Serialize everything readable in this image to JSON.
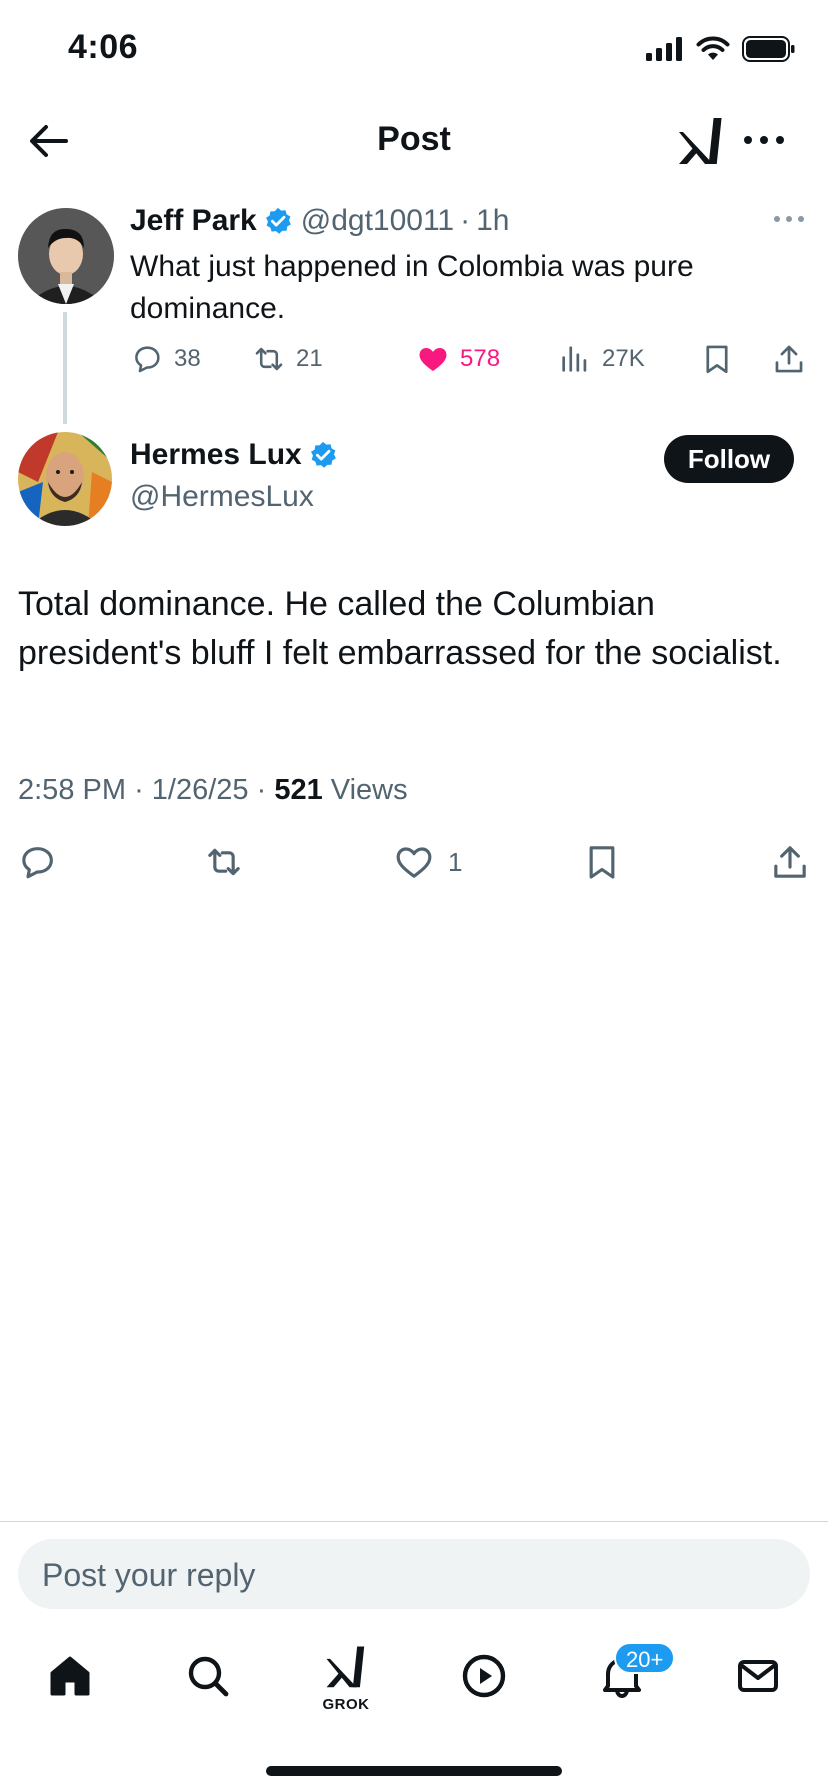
{
  "status_bar": {
    "time": "4:06"
  },
  "header": {
    "title": "Post"
  },
  "parent_post": {
    "author_name": "Jeff Park",
    "handle": "@dgt10011",
    "time_ago": "1h",
    "text": "What just happened in Colombia was pure dominance.",
    "replies": "38",
    "reposts": "21",
    "likes": "578",
    "views": "27K",
    "liked": true
  },
  "main_post": {
    "author_name": "Hermes Lux",
    "handle": "@HermesLux",
    "follow_label": "Follow",
    "text": "Total dominance. He called the Columbian president's bluff I felt embarrassed for the socialist.",
    "time": "2:58 PM",
    "date": "1/26/25",
    "views_count": "521",
    "views_label": "Views",
    "likes": "1"
  },
  "reply": {
    "placeholder": "Post your reply"
  },
  "tabbar": {
    "grok_label": "GROK",
    "notifications_badge": "20+"
  },
  "colors": {
    "text": "#0f1419",
    "secondary": "#536471",
    "verified": "#1d9bf0",
    "like": "#f91880",
    "divider": "#cfd9de",
    "reply_bg": "#eff3f4"
  },
  "icons": [
    "back-arrow-icon",
    "xai-logo-icon",
    "more-icon",
    "verified-icon",
    "reply-icon",
    "repost-icon",
    "like-icon",
    "views-icon",
    "bookmark-icon",
    "share-icon",
    "home-icon",
    "search-icon",
    "grok-icon",
    "video-icon",
    "notifications-icon",
    "messages-icon"
  ]
}
